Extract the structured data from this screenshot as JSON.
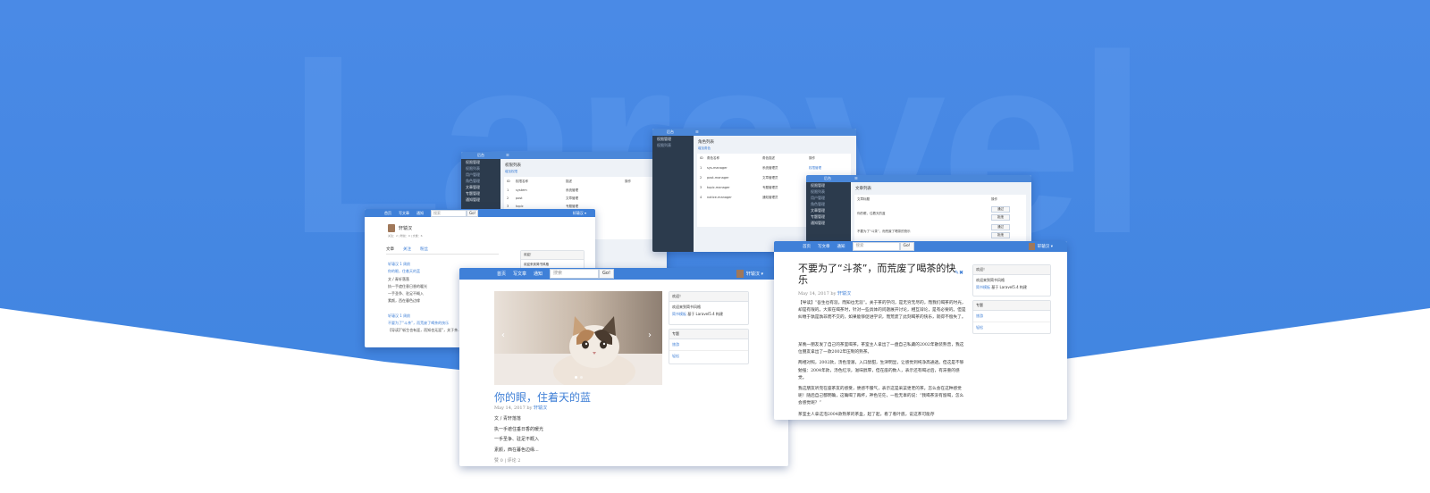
{
  "brand": {
    "watermark": "Laravel",
    "bg_blue": "#4a8ae4",
    "nav_blue": "#3f80d8",
    "dark_sidebar": "#2c3b4d"
  },
  "nav": {
    "home": "首页",
    "write": "写文章",
    "notify": "通知",
    "search_placeholder": "搜索",
    "go": "Go!",
    "user": "轩辕汉 ▾"
  },
  "admin_a": {
    "title": "后台",
    "sidebar": [
      "权限管理",
      "权限列表",
      "用户管理",
      "角色管理",
      "文章管理",
      "专题管理",
      "通知管理"
    ],
    "heading": "权限列表",
    "add": "增加权限",
    "cols": [
      "ID",
      "权限名称",
      "描述",
      "操作"
    ],
    "rows": [
      [
        "1",
        "system",
        "系统管理"
      ],
      [
        "2",
        "post",
        "文章管理"
      ],
      [
        "3",
        "topic",
        "专题管理"
      ]
    ]
  },
  "admin_b": {
    "title": "后台",
    "heading": "角色列表",
    "add": "增加角色",
    "cols": [
      "ID",
      "角色名称",
      "角色描述",
      "操作"
    ],
    "rows": [
      [
        "1",
        "sys-manager",
        "系统管理员"
      ],
      [
        "2",
        "post-manager",
        "文章管理员"
      ],
      [
        "3",
        "topic-manager",
        "专题管理员"
      ],
      [
        "4",
        "notice-manager",
        "通知管理员"
      ]
    ],
    "action": "权限管理"
  },
  "admin_c": {
    "title": "后台",
    "sidebar": [
      "权限管理",
      "权限列表",
      "用户管理",
      "角色管理",
      "文章管理",
      "专题管理",
      "通知管理"
    ],
    "heading": "文章列表",
    "cols": [
      "文章标题",
      "操作"
    ],
    "rows": [
      "你的眼，住着天的蓝",
      "不要为了“斗茶”，而荒废了喝茶的快乐"
    ],
    "pass": "通过",
    "reject": "拒绝"
  },
  "profile": {
    "name": "轩辕汉",
    "stats": "关注：2 | 粉丝：0 | 文章：6",
    "tabs": [
      "文章",
      "关注",
      "粉丝"
    ],
    "posts": [
      {
        "author": "轩辕汉 1 周前",
        "title": "你的眼，住着天的蓝",
        "lines": [
          "文 / 青轩落落",
          "执一手遮住垂日香的暖光",
          "一手圣争、驻足不概入",
          "素颜，西在暮色边缘"
        ]
      },
      {
        "author": "轩辕汉 1 周前",
        "title": "不要为了“斗茶”，而荒废了喝茶的快乐",
        "lines": [
          "【导读】”斩生也有涯，而知也无涯”，关于茶..."
        ]
      }
    ],
    "side_heading": "欢迎！",
    "side_text": "欢迎来到简书风格"
  },
  "post_center": {
    "title": "你的眼，住着天的蓝",
    "meta_date": "May 14, 2017 by",
    "meta_author": "轩辕汉",
    "lines": [
      "文 / 青轩落落",
      "执一手遮住垂日香的暖光",
      "一手圣争、驻足不概入",
      "素颜，西在暮色边缘..."
    ],
    "footer": "赞 0 | 评论 2",
    "side_welcome": "欢迎！",
    "side_welcome_1": "欢迎来到简书风格",
    "side_welcome_2_link": "简书模板",
    "side_welcome_2_rest": " 基于 Laravel5.4 构建",
    "side_topics": "专题",
    "side_topic_items": [
      "旅游",
      "轻松"
    ]
  },
  "post_right": {
    "title": "不要为了“斗茶”，而荒废了喝茶的快乐",
    "meta_date": "May 14, 2017 by",
    "meta_author": "轩辕汉",
    "paragraphs": [
      "【导读】“吾生也有涯，而知也无涯”。关于茶的学问，是无穷无尽的，而我们喝茶的时光，却是有限的。大家在喝茶时，针对一些具体的问题展开讨论，相互辩论，是有必要的。但是纠缠于孰是孰非而不交的，如果能够促进学识，而荒废了此刻喝茶的快乐，就得不偿失了。",
      "某晚一朋友发了自己的茶室喝茶。茶室主人拿出了一盘自己私藏的2002年散装熟普，我这位朋友拿出了一款2002年压制的熟茶。",
      "两相对照，2002款，汤色澄澈，入口醇甜，生津明显，让感觉到纯净高通透。但这是不够勉强：2004年款，汤色红浓，滋味醇厚，但在座的数人，表示还有喝过后，有滞重的感觉。",
      "我这朋友听完在座茶友的感受，便感不服气，表示这是采菜更老的茶。怎么会在这种感觉呢！随后自己都明确，这确喝了再杯，神色茫茫，一脸无辜的说：“我喝茶没有留喝，怎么会感觉呢？”",
      "茶室主人拿这泡2004款熟茶的茶盒，起了起，看了看叶底，说这茶可能存"
    ],
    "side_welcome": "欢迎！",
    "side_welcome_1": "欢迎来到简书风格",
    "side_welcome_2_link": "简书模板",
    "side_welcome_2_rest": " 基于 Laravel5.4 构建",
    "side_topics": "专题",
    "side_topic_items": [
      "旅游",
      "轻松"
    ]
  }
}
